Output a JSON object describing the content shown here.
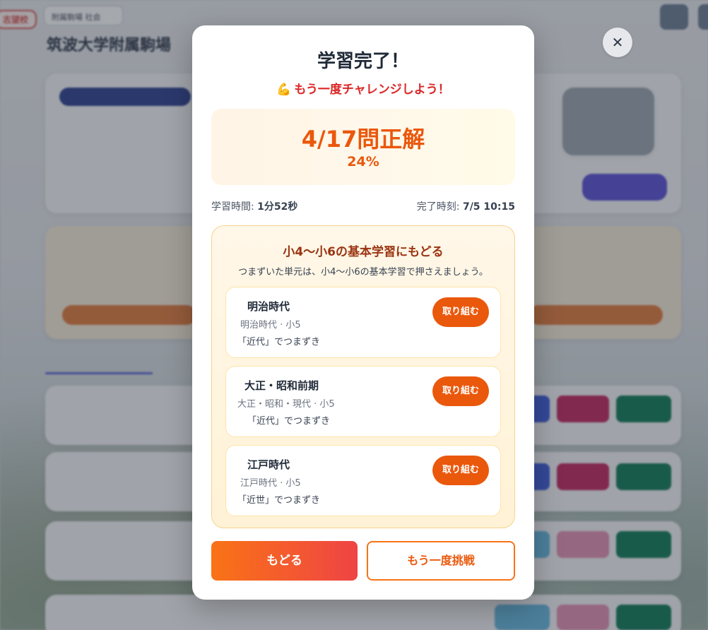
{
  "background": {
    "badge": "志望校",
    "school_select": "附属駒場 社会",
    "page_title": "筑波大学附属駒場"
  },
  "modal": {
    "title": "学習完了！",
    "encourage_icon": "flexed-biceps-icon",
    "encourage": "もう一度チャレンジしよう！",
    "score": "4/17問正解",
    "percent": "24%",
    "meta": {
      "study_time_label": "学習時間: ",
      "study_time_value": "1分52秒",
      "completed_label": "完了時刻: ",
      "completed_value": "7/5 10:15"
    },
    "review": {
      "title": "小4〜小6の基本学習にもどる",
      "subtitle": "つまずいた単元は、小4〜小6の基本学習で押さえましょう。",
      "units": [
        {
          "name": "明治時代",
          "sub": "明治時代 · 小5",
          "note": "「近代」でつまずき",
          "button": "取り組む"
        },
        {
          "name": "大正・昭和前期",
          "sub": "大正・昭和・現代 · 小5",
          "note": "「近代」でつまずき",
          "button": "取り組む"
        },
        {
          "name": "江戸時代",
          "sub": "江戸時代 · 小5",
          "note": "「近世」でつまずき",
          "button": "取り組む"
        }
      ]
    },
    "buttons": {
      "back": "もどる",
      "retry": "もう一度挑戦"
    },
    "close_symbol": "✕"
  },
  "colors": {
    "accent_orange": "#ea580c",
    "encourage_red": "#dc2626",
    "review_border": "#f6d38e"
  }
}
